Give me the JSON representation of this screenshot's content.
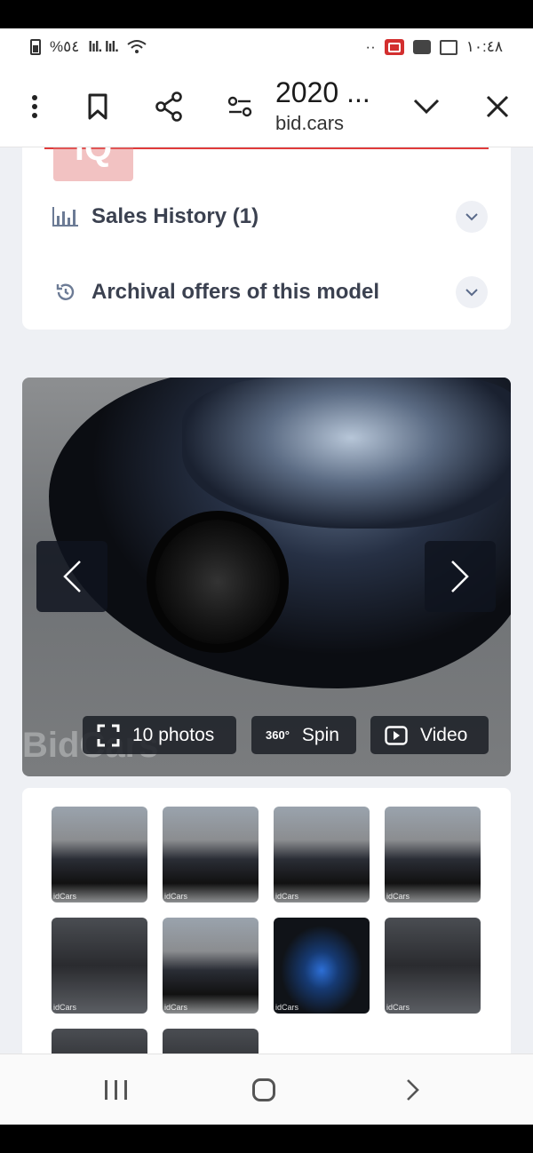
{
  "status_bar": {
    "battery_text": "%٥٤",
    "signal_text": "lıl. lıl.",
    "dots": "··",
    "time": "١٠:٤٨"
  },
  "toolbar": {
    "title": "2020 ...",
    "subtitle": "bid.cars"
  },
  "watermark_logo": "iQ",
  "info_card": {
    "rows": [
      {
        "label": "Sales History (1)",
        "icon": "bar-chart-icon"
      },
      {
        "label": "Archival offers of this model",
        "icon": "history-icon"
      }
    ]
  },
  "gallery": {
    "photos_label": "10 photos",
    "spin_label": "Spin",
    "spin_badge": "360°",
    "video_label": "Video",
    "watermark": "BidCars"
  },
  "thumbnails": {
    "watermark": "idCars",
    "count_visible": 10
  },
  "colors": {
    "accent_red": "#e03b3b",
    "page_bg": "#eef0f4",
    "text_dark": "#3b4150"
  }
}
